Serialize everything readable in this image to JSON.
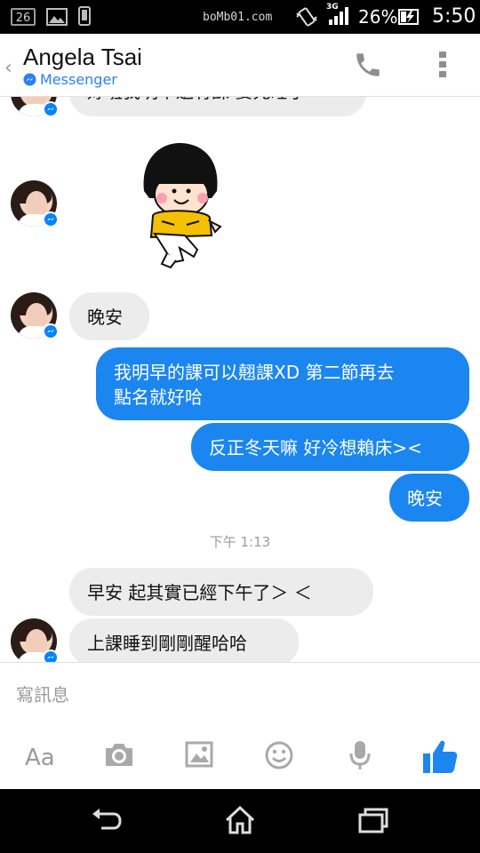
{
  "status_bar": {
    "notification_badge": "26",
    "watermark": "boMb01.com",
    "network": "3G",
    "battery": "26%",
    "time": "5:50"
  },
  "header": {
    "back_icon": "chevron-left",
    "name": "Angela Tsai",
    "platform": "Messenger"
  },
  "messages": {
    "cut_top": "好啦我明早還有課 要先睡了",
    "incoming_1": "晚安",
    "outgoing_1_line1": "我明早的課可以翹課XD 第二節再去",
    "outgoing_1_line2": "點名就好哈",
    "outgoing_2": "反正冬天嘛 好冷想賴床><",
    "outgoing_3": "晚安",
    "timestamp": "下午 1:13",
    "incoming_2": "早安 起其實已經下午了＞ ＜",
    "incoming_3": "上課睡到剛剛醒哈哈"
  },
  "composer": {
    "placeholder": "寫訊息",
    "font_label": "Aa"
  },
  "colors": {
    "accent": "#1b86f0",
    "incoming_bg": "#ececec"
  }
}
